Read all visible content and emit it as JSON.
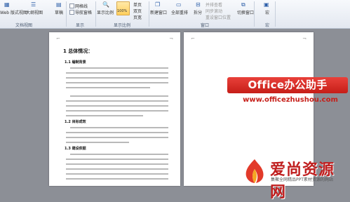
{
  "ribbon": {
    "views": {
      "web_layout": "Web 版式视图",
      "outline": "大纲视图",
      "draft": "草稿",
      "group_label": "文档视图"
    },
    "show": {
      "gridlines": "网格线",
      "nav_pane": "导航窗格",
      "group_label": "显示"
    },
    "zoom": {
      "zoom_btn": "显示比例",
      "percent": "100%",
      "one_page": "单页",
      "two_pages": "双页",
      "page_width": "页宽",
      "group_label": "显示比例"
    },
    "window": {
      "new_window": "新建窗口",
      "arrange_all": "全部重排",
      "split": "拆分",
      "side_by_side": "并排查看",
      "sync_scroll": "同步滚动",
      "reset_position": "重设窗口位置",
      "switch_windows": "切换窗口",
      "group_label": "窗口"
    },
    "macros": {
      "macro_btn": "宏",
      "group_label": "宏"
    }
  },
  "document": {
    "heading": "1 总体情况：",
    "sections": [
      {
        "title": "1.1 编制背景"
      },
      {
        "title": "1.2 目标成效"
      },
      {
        "title": "1.3 建设依据"
      }
    ]
  },
  "watermark": {
    "badge_text": "Office办公助手",
    "url_text": "www.officezhushou.com"
  },
  "brand": {
    "name": "爱尚资源网",
    "subtitle": "集聚全网精品PPT素材资源的网站",
    "color": "#c01f1f"
  },
  "colors": {
    "ribbon_bg": "#e3e8f0",
    "workspace_bg": "#8c8f96",
    "badge_red": "#d42a23"
  }
}
